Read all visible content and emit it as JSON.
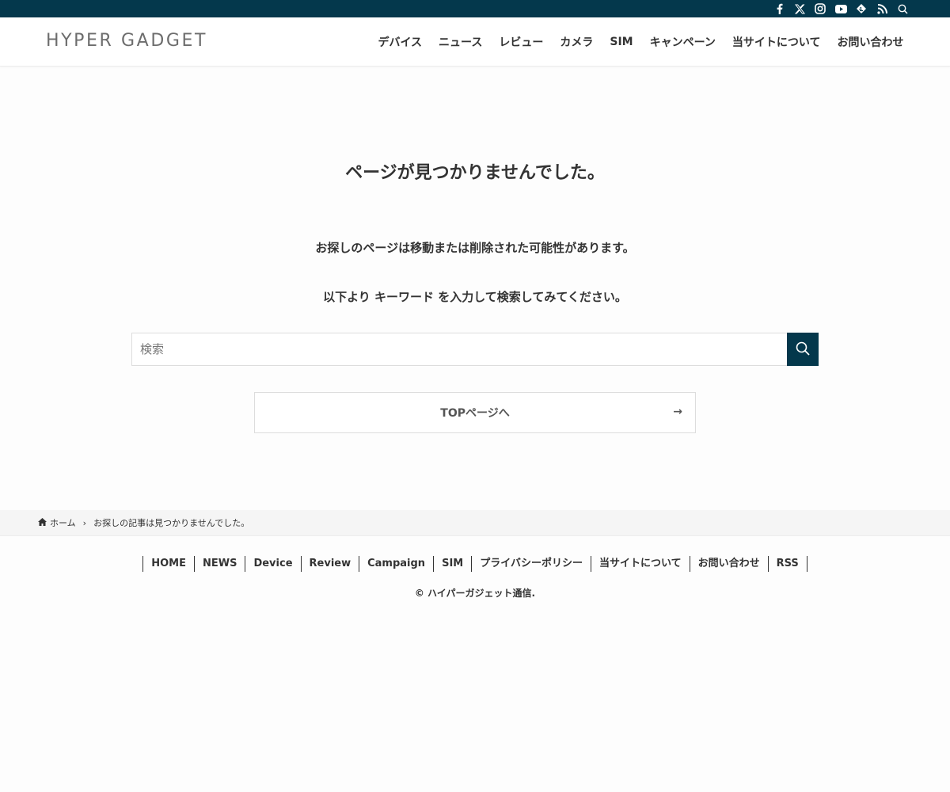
{
  "site": {
    "logo": "HYPER GADGET"
  },
  "topbar": {
    "icons": [
      "facebook-icon",
      "x-icon",
      "instagram-icon",
      "youtube-icon",
      "feedly-icon",
      "rss-icon",
      "search-icon"
    ]
  },
  "nav": {
    "items": [
      {
        "label": "デバイス"
      },
      {
        "label": "ニュース"
      },
      {
        "label": "レビュー"
      },
      {
        "label": "カメラ"
      },
      {
        "label": "SIM"
      },
      {
        "label": "キャンペーン"
      },
      {
        "label": "当サイトについて"
      },
      {
        "label": "お問い合わせ"
      }
    ]
  },
  "main": {
    "title": "ページが見つかりませんでした。",
    "message1": "お探しのページは移動または削除された可能性があります。",
    "message2": "以下より キーワード を入力して検索してみてください。",
    "search_placeholder": "検索",
    "top_button": "TOPページへ",
    "top_button_arrow": "→"
  },
  "breadcrumb": {
    "home": "ホーム",
    "separator": "›",
    "current": "お探しの記事は見つかりませんでした。"
  },
  "footer": {
    "nav": [
      {
        "label": "HOME"
      },
      {
        "label": "NEWS"
      },
      {
        "label": "Device"
      },
      {
        "label": "Review"
      },
      {
        "label": "Campaign"
      },
      {
        "label": "SIM"
      },
      {
        "label": "プライバシーポリシー"
      },
      {
        "label": "当サイトについて"
      },
      {
        "label": "お問い合わせ"
      },
      {
        "label": "RSS"
      }
    ],
    "copyright": "© ハイパーガジェット通信."
  },
  "colors": {
    "brand": "#04384c",
    "background": "#fdfdfd",
    "text": "#333333"
  }
}
